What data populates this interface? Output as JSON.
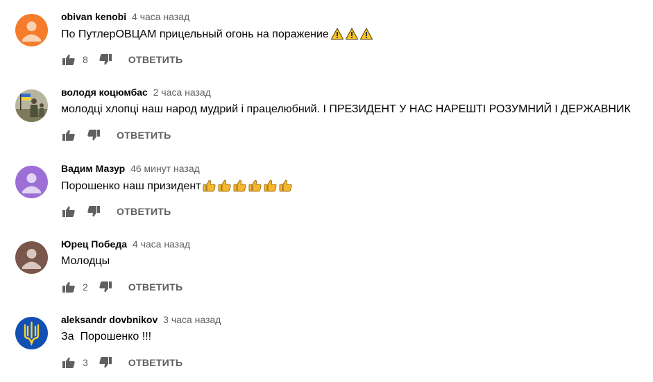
{
  "comments": [
    {
      "author": "obivan kenobi",
      "time": "4 часа назад",
      "text": "По ПутлерОВЦАМ прицельный огонь на поражение",
      "emoji_icons": [
        "warning-icon",
        "warning-icon",
        "warning-icon"
      ],
      "likes": "8",
      "reply_label": "ОТВЕТИТЬ",
      "avatar_color": "#f57c2a"
    },
    {
      "author": "володя коцюмбас",
      "time": "2 часа назад",
      "text": "молодці хлопці наш народ мудрий і працелюбний. І ПРЕЗИДЕНТ У НАС НАРЕШТІ РОЗУМНИЙ І ДЕРЖАВНИК",
      "emoji_icons": [],
      "likes": "",
      "reply_label": "ОТВЕТИТЬ",
      "avatar_color": "#8a8d7a"
    },
    {
      "author": "Вадим Мазур",
      "time": "46 минут назад",
      "text": "Порошенко наш призидент",
      "emoji_icons": [
        "thumbs-up-emoji-icon",
        "thumbs-up-emoji-icon",
        "thumbs-up-emoji-icon",
        "thumbs-up-emoji-icon",
        "thumbs-up-emoji-icon",
        "thumbs-up-emoji-icon"
      ],
      "likes": "",
      "reply_label": "ОТВЕТИТЬ",
      "avatar_color": "#9c6fd6"
    },
    {
      "author": "Юрец Победа",
      "time": "4 часа назад",
      "text": "Молодцы",
      "emoji_icons": [],
      "likes": "2",
      "reply_label": "ОТВЕТИТЬ",
      "avatar_color": "#79574a"
    },
    {
      "author": "aleksandr dovbnikov",
      "time": "3 часа назад",
      "text": "За  Порошенко !!!",
      "emoji_icons": [],
      "likes": "3",
      "reply_label": "ОТВЕТИТЬ",
      "avatar_color": "#1450b4"
    }
  ]
}
